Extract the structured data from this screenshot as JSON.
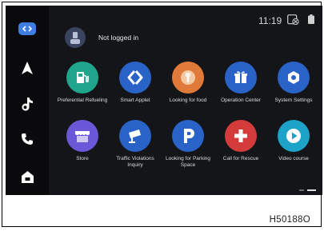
{
  "status": {
    "time": "11:19"
  },
  "user": {
    "login_status": "Not logged in"
  },
  "apps": [
    {
      "label": "Preferential Refueling",
      "icon": "fuel-pump-icon",
      "color": "#1fa58c"
    },
    {
      "label": "Smart Applet",
      "icon": "applet-icon",
      "color": "#2a63c8"
    },
    {
      "label": "Looking for food",
      "icon": "fork-icon",
      "color": "#e07a3a"
    },
    {
      "label": "Operation Center",
      "icon": "gift-icon",
      "color": "#2a63c8"
    },
    {
      "label": "System Settings",
      "icon": "gear-icon",
      "color": "#2a63c8"
    },
    {
      "label": "Store",
      "icon": "store-icon",
      "color": "#6a58d8"
    },
    {
      "label": "Traffic Violations Inquiry",
      "icon": "camera-icon",
      "color": "#2a63c8"
    },
    {
      "label": "Looking for Parking Space",
      "icon": "parking-icon",
      "color": "#2a63c8"
    },
    {
      "label": "Call for Rescue",
      "icon": "rescue-cross-icon",
      "color": "#d43c3c"
    },
    {
      "label": "Video course",
      "icon": "play-icon",
      "color": "#1ea3c8"
    }
  ],
  "figure_code": "H50188O"
}
